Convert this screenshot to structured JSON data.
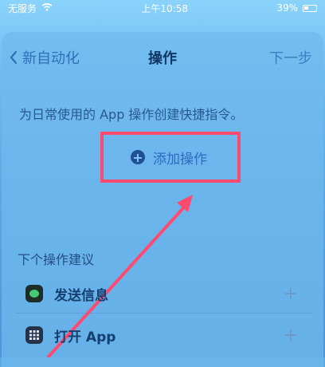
{
  "status_bar": {
    "carrier": "无服务",
    "time": "上午10:58",
    "battery": "39%"
  },
  "nav": {
    "back_label": "新自动化",
    "title": "操作",
    "next_label": "下一步"
  },
  "description": "为日常使用的 App 操作创建快捷指令。",
  "add_action": {
    "label": "添加操作"
  },
  "suggestions": {
    "header": "下个操作建议",
    "items": [
      {
        "label": "发送信息",
        "icon": "message-icon"
      },
      {
        "label": "打开 App",
        "icon": "app-grid-icon"
      }
    ]
  },
  "colors": {
    "annotation": "#ff4a6f",
    "accent": "#2e6fb8"
  }
}
